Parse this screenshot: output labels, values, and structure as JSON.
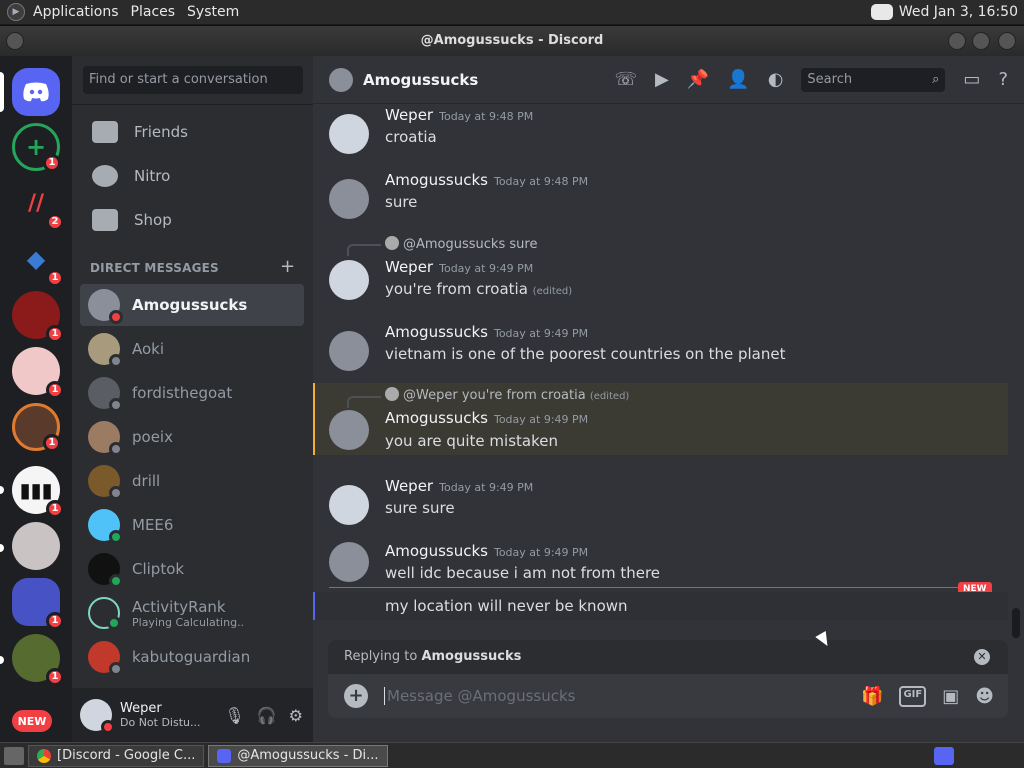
{
  "topbar": {
    "menus": [
      "Applications",
      "Places",
      "System"
    ],
    "clock": "Wed Jan  3, 16:50"
  },
  "window": {
    "title": "@Amogussucks - Discord"
  },
  "guilds": {
    "badges": [
      "1",
      "2",
      "1",
      "1",
      "1",
      "1",
      "1",
      "1",
      "1",
      "1"
    ],
    "new_label": "NEW"
  },
  "sidebar": {
    "search_placeholder": "Find or start a conversation",
    "nav": [
      "Friends",
      "Nitro",
      "Shop"
    ],
    "dm_header": "DIRECT MESSAGES",
    "dms": [
      {
        "name": "Amogussucks",
        "status_color": "#f23f43"
      },
      {
        "name": "Aoki",
        "status_color": "#80848e"
      },
      {
        "name": "fordisthegoat",
        "status_color": "#80848e"
      },
      {
        "name": "poeix",
        "status_color": "#80848e"
      },
      {
        "name": "drill",
        "status_color": "#80848e"
      },
      {
        "name": "MEE6",
        "status_color": "#23a55a"
      },
      {
        "name": "Cliptok",
        "status_color": "#23a55a"
      },
      {
        "name": "ActivityRank",
        "sub": "Playing Calculating..",
        "status_color": "#23a55a"
      },
      {
        "name": "kabutoguardian",
        "status_color": "#80848e"
      }
    ]
  },
  "user": {
    "name": "Weper",
    "status": "Do Not Distu..."
  },
  "chat": {
    "title": "Amogussucks",
    "search_placeholder": "Search",
    "messages": [
      {
        "author": "Weper",
        "time": "Today at 9:48 PM",
        "text": "croatia"
      },
      {
        "author": "Amogussucks",
        "time": "Today at 9:48 PM",
        "text": "sure"
      },
      {
        "reply_to": "@Amogussucks",
        "reply_text": "sure",
        "author": "Weper",
        "time": "Today at 9:49 PM",
        "text": "you're from croatia",
        "edited": "(edited)"
      },
      {
        "author": "Amogussucks",
        "time": "Today at 9:49 PM",
        "text": "vietnam is one of the poorest countries on the planet"
      },
      {
        "reply_to": "@Weper",
        "reply_text": "you're from croatia",
        "reply_edited": "(edited)",
        "author": "Amogussucks",
        "time": "Today at 9:49 PM",
        "text": "you are quite mistaken"
      },
      {
        "author": "Weper",
        "time": "Today at 9:49 PM",
        "text": "sure sure"
      },
      {
        "author": "Amogussucks",
        "time": "Today at 9:49 PM",
        "text": "well idc because i am not from there"
      },
      {
        "text": "my location will never be known"
      }
    ],
    "new_label": "NEW",
    "replying_prefix": "Replying to",
    "replying_name": "Amogussucks",
    "composer_placeholder": "Message @Amogussucks",
    "gif_label": "GIF"
  },
  "taskbar": {
    "tasks": [
      "[Discord - Google C...",
      "@Amogussucks - Di..."
    ]
  },
  "colors": {
    "blurple": "#5865f2",
    "dnd_red": "#f23f43",
    "online_green": "#23a55a",
    "mention_gold": "#f0b132"
  }
}
